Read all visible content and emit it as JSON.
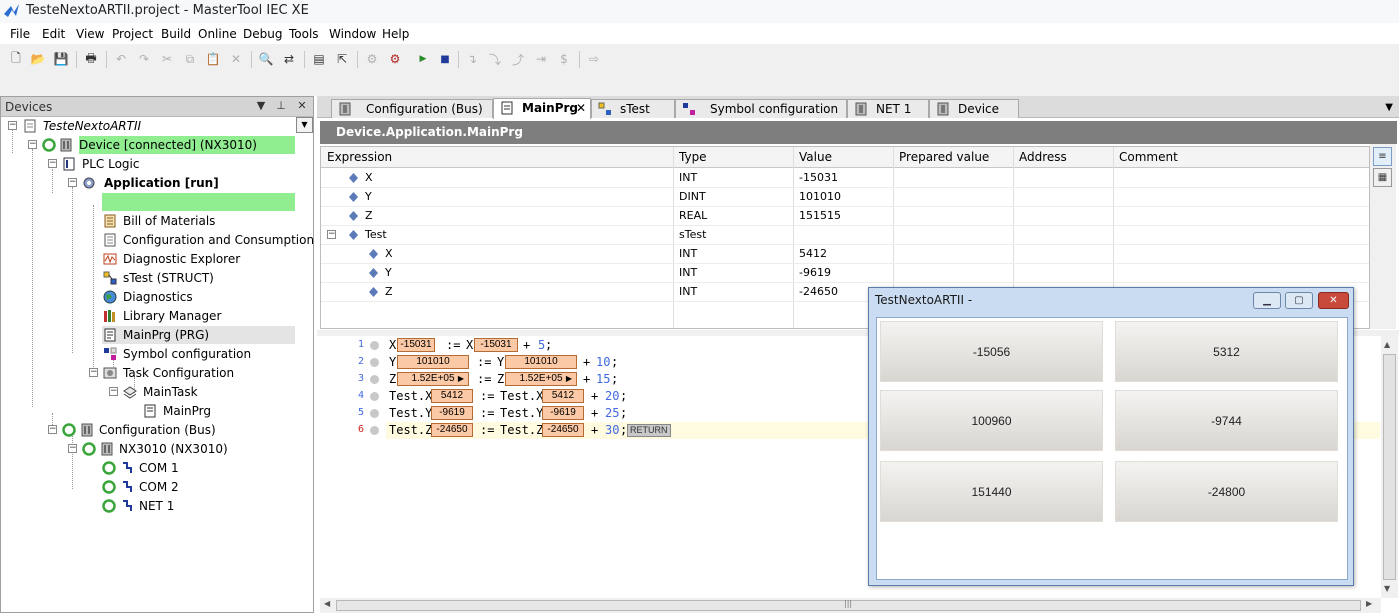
{
  "window": {
    "title": "TesteNextoARTII.project - MasterTool IEC XE"
  },
  "menu": [
    "File",
    "Edit",
    "View",
    "Project",
    "Build",
    "Online",
    "Debug",
    "Tools",
    "Window",
    "Help"
  ],
  "devices_panel": {
    "title": "Devices",
    "tree": {
      "project": "TesteNextoARTII",
      "device": "Device [connected] (NX3010)",
      "plc_logic": "PLC Logic",
      "application": "Application [run]",
      "app_children": [
        "Bill of Materials",
        "Configuration and Consumption",
        "Diagnostic Explorer",
        "sTest (STRUCT)",
        "Diagnostics",
        "Library Manager",
        "MainPrg (PRG)",
        "Symbol configuration",
        "Task Configuration"
      ],
      "main_task": "MainTask",
      "main_prg_call": "MainPrg",
      "config_bus": "Configuration (Bus)",
      "nx3010": "NX3010 (NX3010)",
      "ports": [
        "COM 1",
        "COM 2",
        "NET 1"
      ]
    }
  },
  "tabs": [
    {
      "label": "Configuration (Bus)"
    },
    {
      "label": "MainPrg"
    },
    {
      "label": "sTest"
    },
    {
      "label": "Symbol configuration"
    },
    {
      "label": "NET 1"
    },
    {
      "label": "Device"
    }
  ],
  "path_bar": "Device.Application.MainPrg",
  "watch": {
    "columns": [
      "Expression",
      "Type",
      "Value",
      "Prepared value",
      "Address",
      "Comment"
    ],
    "rows": [
      {
        "expr": "X",
        "type": "INT",
        "value": "-15031"
      },
      {
        "expr": "Y",
        "type": "DINT",
        "value": "101010"
      },
      {
        "expr": "Z",
        "type": "REAL",
        "value": "151515"
      },
      {
        "expr": "Test",
        "type": "sTest",
        "value": ""
      },
      {
        "expr": "X",
        "type": "INT",
        "value": "5412"
      },
      {
        "expr": "Y",
        "type": "INT",
        "value": "-9619"
      },
      {
        "expr": "Z",
        "type": "INT",
        "value": "-24650"
      }
    ]
  },
  "code": {
    "line_numbers": [
      "1",
      "2",
      "3",
      "4",
      "5",
      "6"
    ],
    "inline_values": {
      "x": "-15031",
      "y": "101010",
      "z": "1.52E+05",
      "tx": "5412",
      "ty": "-9619",
      "tz": "-24650"
    },
    "tokens": {
      "X": "X",
      "Y": "Y",
      "Z": "Z",
      "TX": "Test.X",
      "TY": "Test.Y",
      "TZ": "Test.Z",
      "assign": ":=",
      "plus": "+",
      "n5": "5",
      "n10": "10",
      "n15": "15",
      "n20": "20",
      "n25": "25",
      "n30": "30",
      "semi": ";"
    },
    "return_label": "RETURN"
  },
  "popup": {
    "title": "TestNextoARTII -",
    "values": [
      "-15056",
      "5312",
      "100960",
      "-9744",
      "151440",
      "-24800"
    ]
  }
}
